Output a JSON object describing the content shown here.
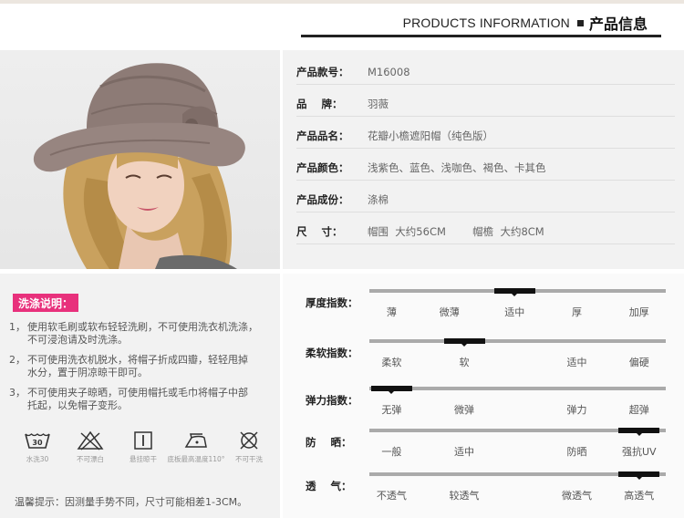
{
  "header": {
    "title_en": "PRODUCTS INFORMATION",
    "title_cn": "产品信息"
  },
  "specs": [
    {
      "label": "产品款号：",
      "value": "M16008"
    },
    {
      "label": "品    牌：",
      "value": "羽薇"
    },
    {
      "label": "产品品名：",
      "value": "花瓣小檐遮阳帽（纯色版）"
    },
    {
      "label": "产品颜色：",
      "value": "浅紫色、蓝色、浅咖色、褐色、卡其色"
    },
    {
      "label": "产品成份：",
      "value": "涤棉"
    },
    {
      "label": "尺    寸：",
      "value": "帽围  大约56CM        帽檐  大约8CM"
    }
  ],
  "care": {
    "title": "洗涤说明：",
    "items": [
      {
        "num": "1，",
        "line1": "使用软毛刷或软布轻轻洗刷，不可使用洗衣机洗涤，",
        "line2": "不可浸泡请及时洗涤。"
      },
      {
        "num": "2，",
        "line1": "不可使用洗衣机脱水，将帽子折成四瓣，轻轻甩掉",
        "line2": "水分，置于阴凉晾干即可。"
      },
      {
        "num": "3，",
        "line1": "不可使用夹子晾晒，可使用帽托或毛巾将帽子中部",
        "line2": "托起，以免帽子变形。"
      }
    ],
    "icons": [
      {
        "icon": "wash-30-icon",
        "num": "30",
        "label": "水洗30"
      },
      {
        "icon": "no-bleach-icon",
        "label": "不可漂白"
      },
      {
        "icon": "hang-dry-icon",
        "label": "悬挂晾干"
      },
      {
        "icon": "iron-low-icon",
        "label": "底板最高温度110°"
      },
      {
        "icon": "no-dry-clean-icon",
        "label": "不可干洗"
      }
    ],
    "tip": "温馨提示：因测量手势不同，尺寸可能相差1-3CM。"
  },
  "indexes": [
    {
      "label": "厚度指数：",
      "options": [
        "薄",
        "微薄",
        "适中",
        "厚",
        "加厚"
      ],
      "selected": 2
    },
    {
      "label": "柔软指数：",
      "options": [
        "柔软",
        "软",
        "适中",
        "偏硬"
      ],
      "selected": 1
    },
    {
      "label": "弹力指数：",
      "options": [
        "无弹",
        "微弹",
        "弹力",
        "超弹"
      ],
      "selected": 0
    },
    {
      "label": "防    晒：",
      "options": [
        "一般",
        "适中",
        "防晒",
        "强抗UV"
      ],
      "selected": 3
    },
    {
      "label": "透    气：",
      "options": [
        "不透气",
        "较透气",
        "微透气",
        "高透气"
      ],
      "selected": 3
    }
  ],
  "colors": {
    "accent_pink": "#e8317c",
    "hat": "#8d7b76",
    "hair": "#c8a05c"
  }
}
